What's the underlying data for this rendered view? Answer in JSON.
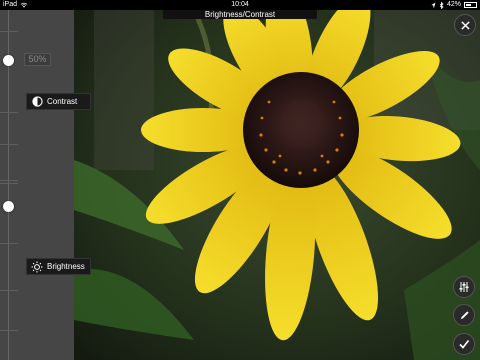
{
  "status_bar": {
    "device": "iPad",
    "time": "10:04",
    "battery": "42%"
  },
  "header": {
    "title": "Brightness/Contrast"
  },
  "panel": {
    "contrast_value": "50%",
    "tabs": [
      {
        "label": "Contrast",
        "icon": "contrast-icon"
      },
      {
        "label": "Brightness",
        "icon": "sun-icon"
      }
    ]
  },
  "actions": {
    "close": "close-icon",
    "adjust": "sliders-icon",
    "draw": "pencil-icon",
    "done": "checkmark-icon"
  },
  "colors": {
    "petal": "#f2d21a",
    "center": "#2a1614",
    "panel": "#464646"
  }
}
